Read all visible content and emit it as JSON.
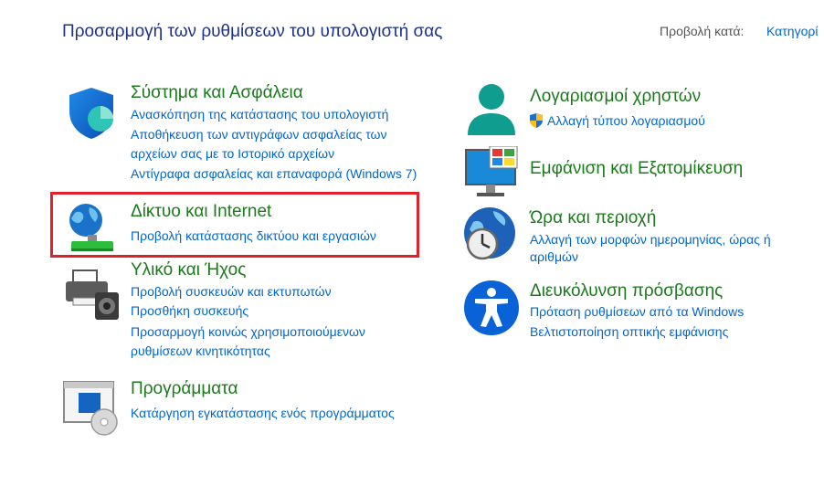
{
  "header": {
    "title": "Προσαρμογή των ρυθμίσεων του υπολογιστή σας",
    "view_by_label": "Προβολή κατά:",
    "view_by_value": "Κατηγορί"
  },
  "categories": [
    {
      "icon": "shield-security-icon",
      "title": "Σύστημα και Ασφάλεια",
      "links": [
        "Ανασκόπηση της κατάστασης του υπολογιστή",
        "Αποθήκευση των αντιγράφων ασφαλείας των",
        "αρχείων σας με το Ιστορικό αρχείων",
        "Αντίγραφα ασφαλείας και επαναφορά (Windows 7)"
      ]
    },
    {
      "icon": "network-globe-icon",
      "title": "Δίκτυο και Internet",
      "links": [
        "Προβολή κατάστασης δικτύου και εργασιών"
      ]
    },
    {
      "icon": "printer-speaker-icon",
      "title": "Υλικό και Ήχος",
      "links": [
        "Προβολή συσκευών και εκτυπωτών",
        "Προσθήκη συσκευής",
        "Προσαρμογή κοινώς χρησιμοποιούμενων",
        "ρυθμίσεων κινητικότητας"
      ]
    },
    {
      "icon": "programs-disc-icon",
      "title": "Προγράμματα",
      "links": [
        "Κατάργηση εγκατάστασης ενός προγράμματος"
      ]
    },
    {
      "icon": "user-accounts-icon",
      "title": "Λογαριασμοί χρηστών",
      "links": [
        "Αλλαγή τύπου λογαριασμού"
      ]
    },
    {
      "icon": "appearance-monitor-icon",
      "title": "Εμφάνιση και Εξατομίκευση",
      "links": []
    },
    {
      "icon": "clock-region-icon",
      "title": "Ώρα και περιοχή",
      "links": [
        "Αλλαγή των μορφών ημερομηνίας, ώρας ή",
        "αριθμών"
      ]
    },
    {
      "icon": "accessibility-icon",
      "title": "Διευκόλυνση πρόσβασης",
      "links": [
        "Πρόταση ρυθμίσεων από τα Windows",
        "Βελτιστοποίηση οπτικής εμφάνισης"
      ]
    }
  ],
  "colors": {
    "heading": "#1e3287",
    "category_title": "#1b7a1b",
    "link": "#0066cc",
    "highlight": "#e0212b"
  }
}
